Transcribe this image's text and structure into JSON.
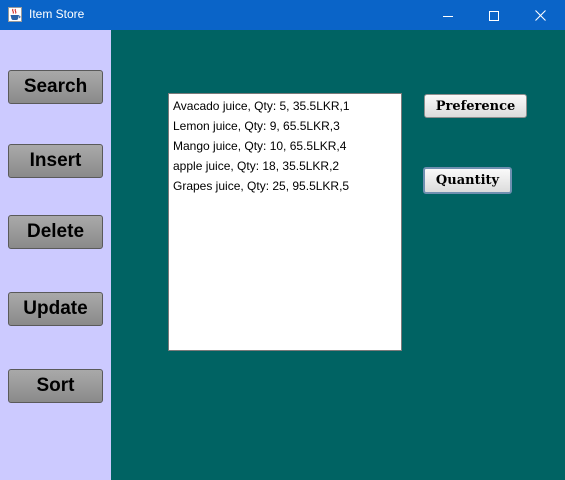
{
  "window": {
    "title": "Item Store",
    "controls": [
      "minimize",
      "maximize",
      "close"
    ]
  },
  "sidebar": {
    "buttons": [
      {
        "label": "Search"
      },
      {
        "label": "Insert"
      },
      {
        "label": "Delete"
      },
      {
        "label": "Update"
      },
      {
        "label": "Sort"
      }
    ]
  },
  "main": {
    "list_items": [
      "Avacado juice, Qty: 5, 35.5LKR,1",
      "Lemon juice, Qty: 9, 65.5LKR,3",
      "Mango juice, Qty: 10, 65.5LKR,4",
      "apple juice, Qty: 18, 35.5LKR,2",
      "Grapes juice, Qty: 25, 95.5LKR,5"
    ],
    "buttons": {
      "preference": "Preference",
      "quantity": "Quantity"
    }
  },
  "colors": {
    "titlebar": "#0a64c8",
    "sidebar": "#cccaff",
    "main_panel": "#006363",
    "list_background": "#ffffff"
  },
  "icons": [
    "java-coffee-cup-icon",
    "minimize-icon",
    "maximize-icon",
    "close-icon"
  ]
}
